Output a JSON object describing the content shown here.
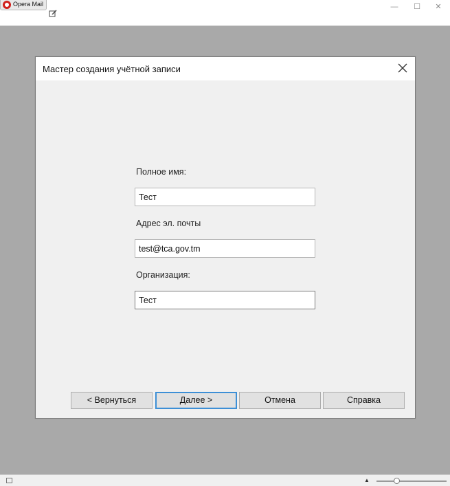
{
  "app": {
    "tab_label": "Opera Mail",
    "icons": {
      "app_logo": "opera-icon",
      "compose": "compose-icon"
    },
    "window_controls": {
      "minimize": "—",
      "maximize": "☐",
      "close": "✕"
    }
  },
  "dialog": {
    "title": "Мастер создания учётной записи",
    "close_icon": "close-icon",
    "fields": {
      "full_name": {
        "label": "Полное имя:",
        "value": "Тест"
      },
      "email": {
        "label": "Адрес эл. почты",
        "value": "test@tca.gov.tm"
      },
      "organization": {
        "label": "Организация:",
        "value": "Тест"
      }
    },
    "buttons": {
      "back": "< Вернуться",
      "next": "Далее >",
      "cancel": "Отмена",
      "help": "Справка"
    },
    "colors": {
      "default_button_border": "#3d8fd6"
    }
  },
  "statusbar": {
    "zoom_arrow": "▲",
    "zoom_level": 0.27
  }
}
